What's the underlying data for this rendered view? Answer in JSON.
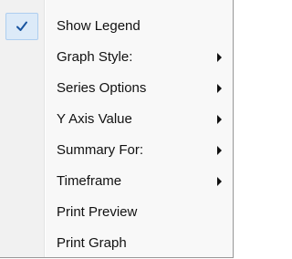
{
  "context_menu": {
    "items": [
      {
        "label": "Show Legend",
        "checked": true,
        "has_submenu": false
      },
      {
        "label": "Graph Style:",
        "checked": false,
        "has_submenu": true
      },
      {
        "label": "Series Options",
        "checked": false,
        "has_submenu": true
      },
      {
        "label": "Y Axis Value",
        "checked": false,
        "has_submenu": true
      },
      {
        "label": "Summary For:",
        "checked": false,
        "has_submenu": true
      },
      {
        "label": "Timeframe",
        "checked": false,
        "has_submenu": true
      },
      {
        "label": "Print Preview",
        "checked": false,
        "has_submenu": false
      },
      {
        "label": "Print Graph",
        "checked": false,
        "has_submenu": false
      }
    ],
    "icons": {
      "check": "check-icon",
      "submenu": "submenu-arrow-icon"
    },
    "colors": {
      "check_highlight_fill": "#dceaf8",
      "check_highlight_border": "#aeceef",
      "check_mark": "#1a55a0"
    }
  }
}
